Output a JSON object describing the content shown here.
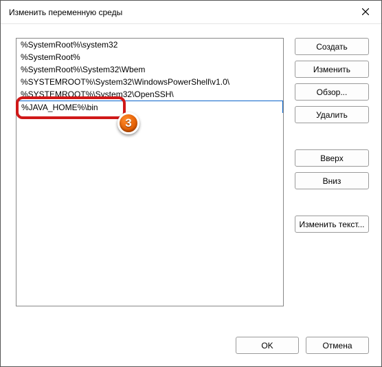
{
  "window": {
    "title": "Изменить переменную среды"
  },
  "list": {
    "items": [
      "%SystemRoot%\\system32",
      "%SystemRoot%",
      "%SystemRoot%\\System32\\Wbem",
      "%SYSTEMROOT%\\System32\\WindowsPowerShell\\v1.0\\",
      "%SYSTEMROOT%\\System32\\OpenSSH\\"
    ],
    "editing_value": "%JAVA_HOME%\\bin"
  },
  "buttons": {
    "create": "Создать",
    "edit": "Изменить",
    "browse": "Обзор...",
    "delete": "Удалить",
    "up": "Вверх",
    "down": "Вниз",
    "edit_text": "Изменить текст...",
    "ok": "OK",
    "cancel": "Отмена"
  },
  "annotation": {
    "step": "3"
  }
}
